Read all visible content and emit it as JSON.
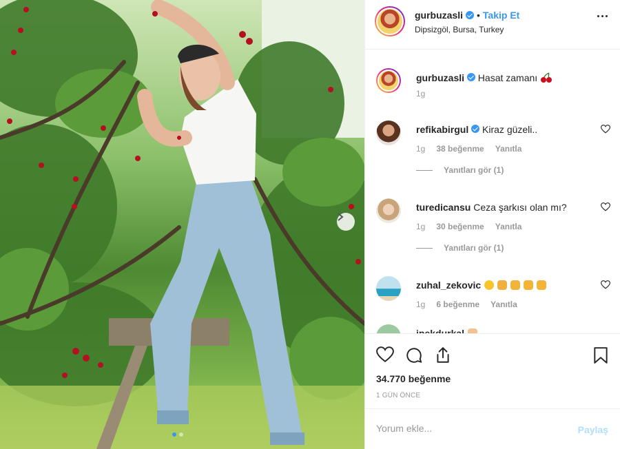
{
  "post": {
    "username": "gurbuzasli",
    "separator": "•",
    "follow_label": "Takip Et",
    "location": "Dipsizgöl, Bursa, Turkey",
    "image_alt": "Woman picking cherries from a tree while standing on a ladder",
    "carousel": {
      "total": 2,
      "active": 1
    }
  },
  "caption": {
    "username": "gurbuzasli",
    "text": "Hasat zamanı",
    "emoji": "cherries",
    "time": "1g"
  },
  "comments": [
    {
      "username": "refikabirgul",
      "verified": true,
      "text": "Kiraz güzeli..",
      "time": "1g",
      "likes": "38 beğenme",
      "reply_label": "Yanıtla",
      "view_replies": "Yanıtları gör (1)"
    },
    {
      "username": "turedicansu",
      "verified": false,
      "text": "Ceza şarkısı olan mı?",
      "time": "1g",
      "likes": "30 beğenme",
      "reply_label": "Yanıtla",
      "view_replies": "Yanıtları gör (1)"
    },
    {
      "username": "zuhal_zekovic",
      "verified": false,
      "text": "",
      "emojis": [
        "tears-of-joy",
        "folded-hands",
        "clapping-hands",
        "clapping-hands",
        "clapping-hands"
      ],
      "time": "1g",
      "likes": "6 beğenme",
      "reply_label": "Yanıtla"
    },
    {
      "username": "ipekdurkal",
      "verified": false,
      "text": "",
      "emojis": [
        "victory-hand"
      ]
    }
  ],
  "actions": {
    "likes_count": "34.770 beğenme",
    "posted_ago": "1 GÜN ÖNCE",
    "comment_placeholder": "Yorum ekle...",
    "post_label": "Paylaş"
  },
  "colors": {
    "accent": "#3897f0",
    "text": "#262626",
    "muted": "#999999",
    "divider": "#efefef",
    "post_disabled": "#b2dffc"
  }
}
